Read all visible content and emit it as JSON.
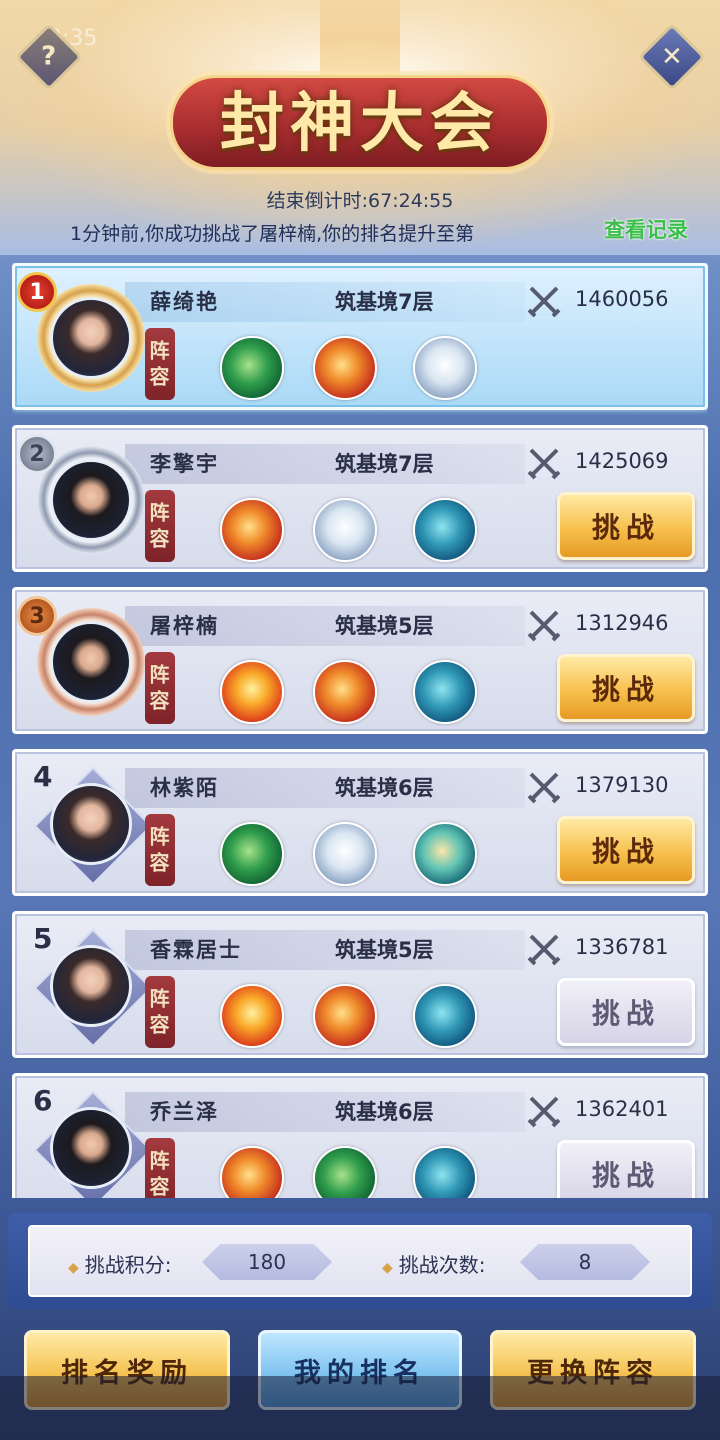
{
  "status_bar": {
    "time": "9:35"
  },
  "header": {
    "title": "封神大会",
    "countdown": "结束倒计时:67:24:55",
    "notice": "1分钟前,你成功挑战了屠梓楠,你的排名提升至第",
    "view_record": "查看记录"
  },
  "corner_buttons": {
    "left_icon": "diamond-menu-icon",
    "right_icon": "close-x-icon",
    "left_glyph": "?",
    "right_glyph": "✕"
  },
  "colors": {
    "accent_gold": "#f5c251",
    "accent_blue": "#4f98d6",
    "record_green": "#3bbf4a"
  },
  "lineup_label": "阵容",
  "ranking": [
    {
      "rank": "1",
      "name": "薛绮艳",
      "realm": "筑基境7层",
      "power": "1460056",
      "lineup": [
        "dragon-green",
        "dragon-red",
        "tiger"
      ],
      "button": ""
    },
    {
      "rank": "2",
      "name": "李擎宇",
      "realm": "筑基境7层",
      "power": "1425069",
      "lineup": [
        "dragon-red",
        "tiger",
        "whale"
      ],
      "button": "挑战"
    },
    {
      "rank": "3",
      "name": "屠梓楠",
      "realm": "筑基境5层",
      "power": "1312946",
      "lineup": [
        "phoenix",
        "dragon-red",
        "whale"
      ],
      "button": "挑战"
    },
    {
      "rank": "4",
      "name": "林紫陌",
      "realm": "筑基境6层",
      "power": "1379130",
      "lineup": [
        "dragon-green",
        "tiger",
        "dragon-teal"
      ],
      "button": "挑战"
    },
    {
      "rank": "5",
      "name": "香霖居士",
      "realm": "筑基境5层",
      "power": "1336781",
      "lineup": [
        "phoenix",
        "dragon-red",
        "whale"
      ],
      "button": "挑战"
    },
    {
      "rank": "6",
      "name": "乔兰泽",
      "realm": "筑基境6层",
      "power": "1362401",
      "lineup": [
        "dragon-red",
        "dragon-green",
        "whale"
      ],
      "button": "挑战"
    }
  ],
  "stats": {
    "score_label": "挑战积分:",
    "score_value": "180",
    "count_label": "挑战次数:",
    "count_value": "8"
  },
  "footer": {
    "rewards": "排名奖励",
    "my_rank": "我的排名",
    "change_lineup": "更换阵容"
  }
}
